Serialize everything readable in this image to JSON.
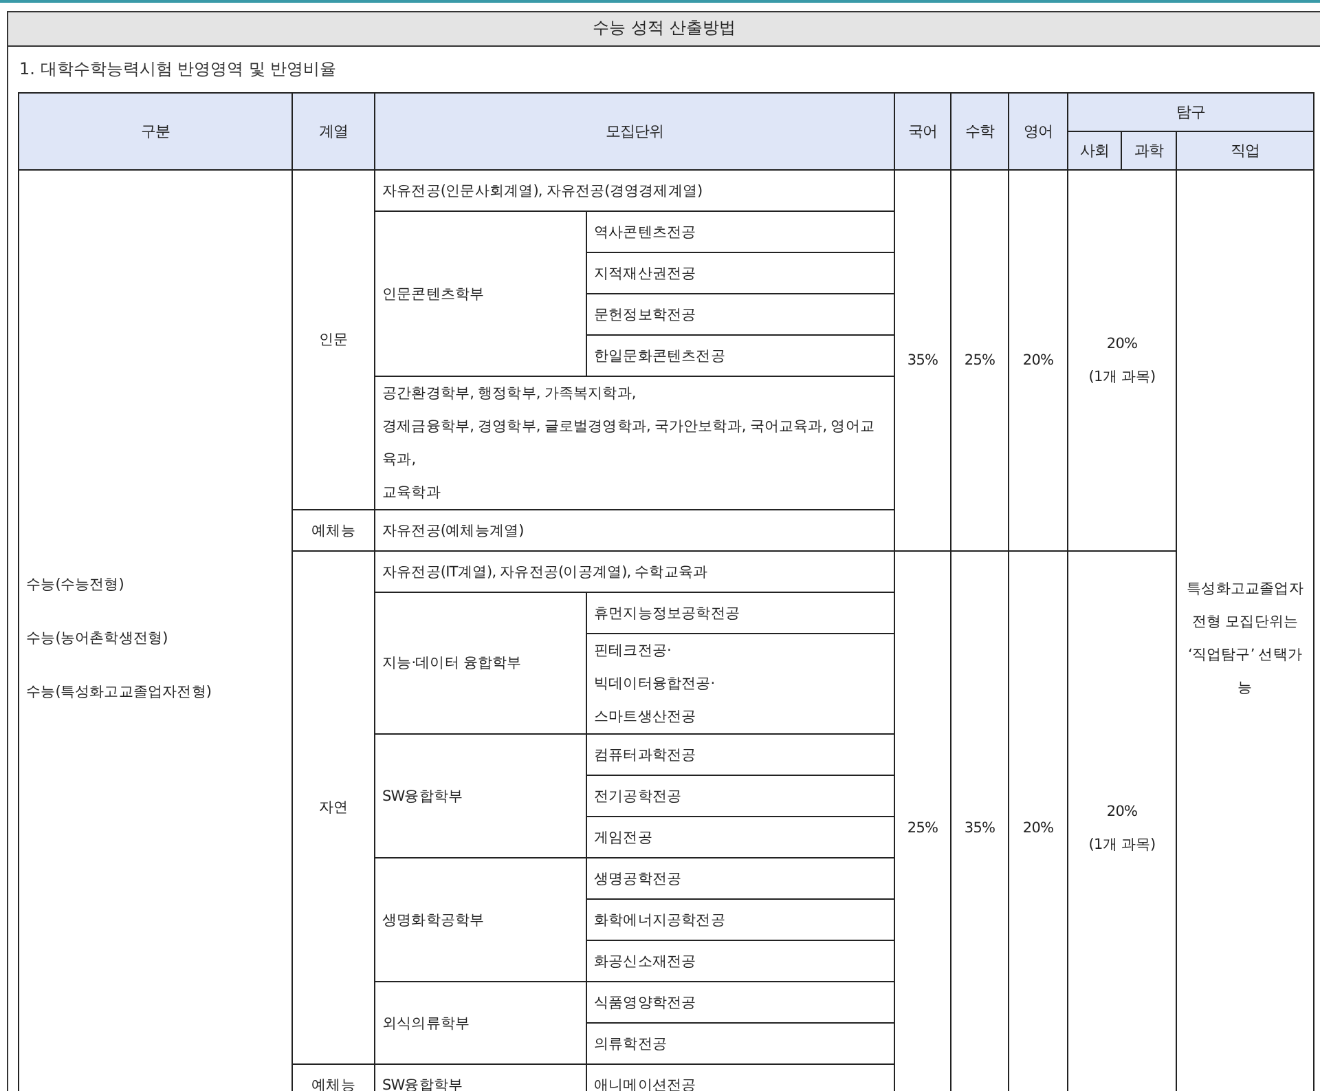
{
  "title": "수능 성적 산출방법",
  "section_heading": "1. 대학수학능력시험 반영영역 및 반영비율",
  "table": {
    "headers": {
      "category": "구분",
      "track": "계열",
      "unit": "모집단위",
      "korean": "국어",
      "math": "수학",
      "english": "영어",
      "inquiry": "탐구",
      "social": "사회",
      "science": "과학",
      "vocational": "직업"
    },
    "categories": [
      "수능(수능전형)",
      "수능(농어촌학생전형)",
      "수능(특성화고교졸업자전형)"
    ],
    "vocational_note": "특성화고교졸업자전형 모집단위는 ‘직업탐구’ 선택가능",
    "sections": [
      {
        "korean": "35%",
        "math": "25%",
        "english": "20%",
        "inquiry": "20%",
        "inquiry_note": "(1개 과목)",
        "tracks": [
          {
            "name": "인문",
            "units": [
              {
                "name": "자유전공(인문사회계열), 자유전공(경영경제계열)"
              },
              {
                "name": "인문콘텐츠학부",
                "majors": [
                  "역사콘텐츠전공",
                  "지적재산권전공",
                  "문헌정보학전공",
                  "한일문화콘텐츠전공"
                ]
              },
              {
                "name": "공간환경학부, 행정학부, 가족복지학과,\n경제금융학부, 경영학부, 글로벌경영학과, 국가안보학과, 국어교육과, 영어교육과,\n교육학과"
              }
            ]
          },
          {
            "name": "예체능",
            "units": [
              {
                "name": "자유전공(예체능계열)"
              }
            ]
          }
        ]
      },
      {
        "korean": "25%",
        "math": "35%",
        "english": "20%",
        "inquiry": "20%",
        "inquiry_note": "(1개 과목)",
        "tracks": [
          {
            "name": "자연",
            "units": [
              {
                "name": "자유전공(IT계열), 자유전공(이공계열), 수학교육과"
              },
              {
                "name": "지능·데이터 융합학부",
                "majors": [
                  "휴먼지능정보공학전공",
                  "핀테크전공·\n빅데이터융합전공·\n스마트생산전공"
                ]
              },
              {
                "name": "SW융합학부",
                "majors": [
                  "컴퓨터과학전공",
                  "전기공학전공",
                  "게임전공"
                ]
              },
              {
                "name": "생명화학공학부",
                "majors": [
                  "생명공학전공",
                  "화학에너지공학전공",
                  "화공신소재전공"
                ]
              },
              {
                "name": "외식의류학부",
                "majors": [
                  "식품영양학전공",
                  "의류학전공"
                ]
              }
            ]
          },
          {
            "name": "예체능",
            "units": [
              {
                "name": "SW융합학부",
                "majors": [
                  "애니메이션전공"
                ]
              }
            ]
          }
        ]
      }
    ]
  }
}
